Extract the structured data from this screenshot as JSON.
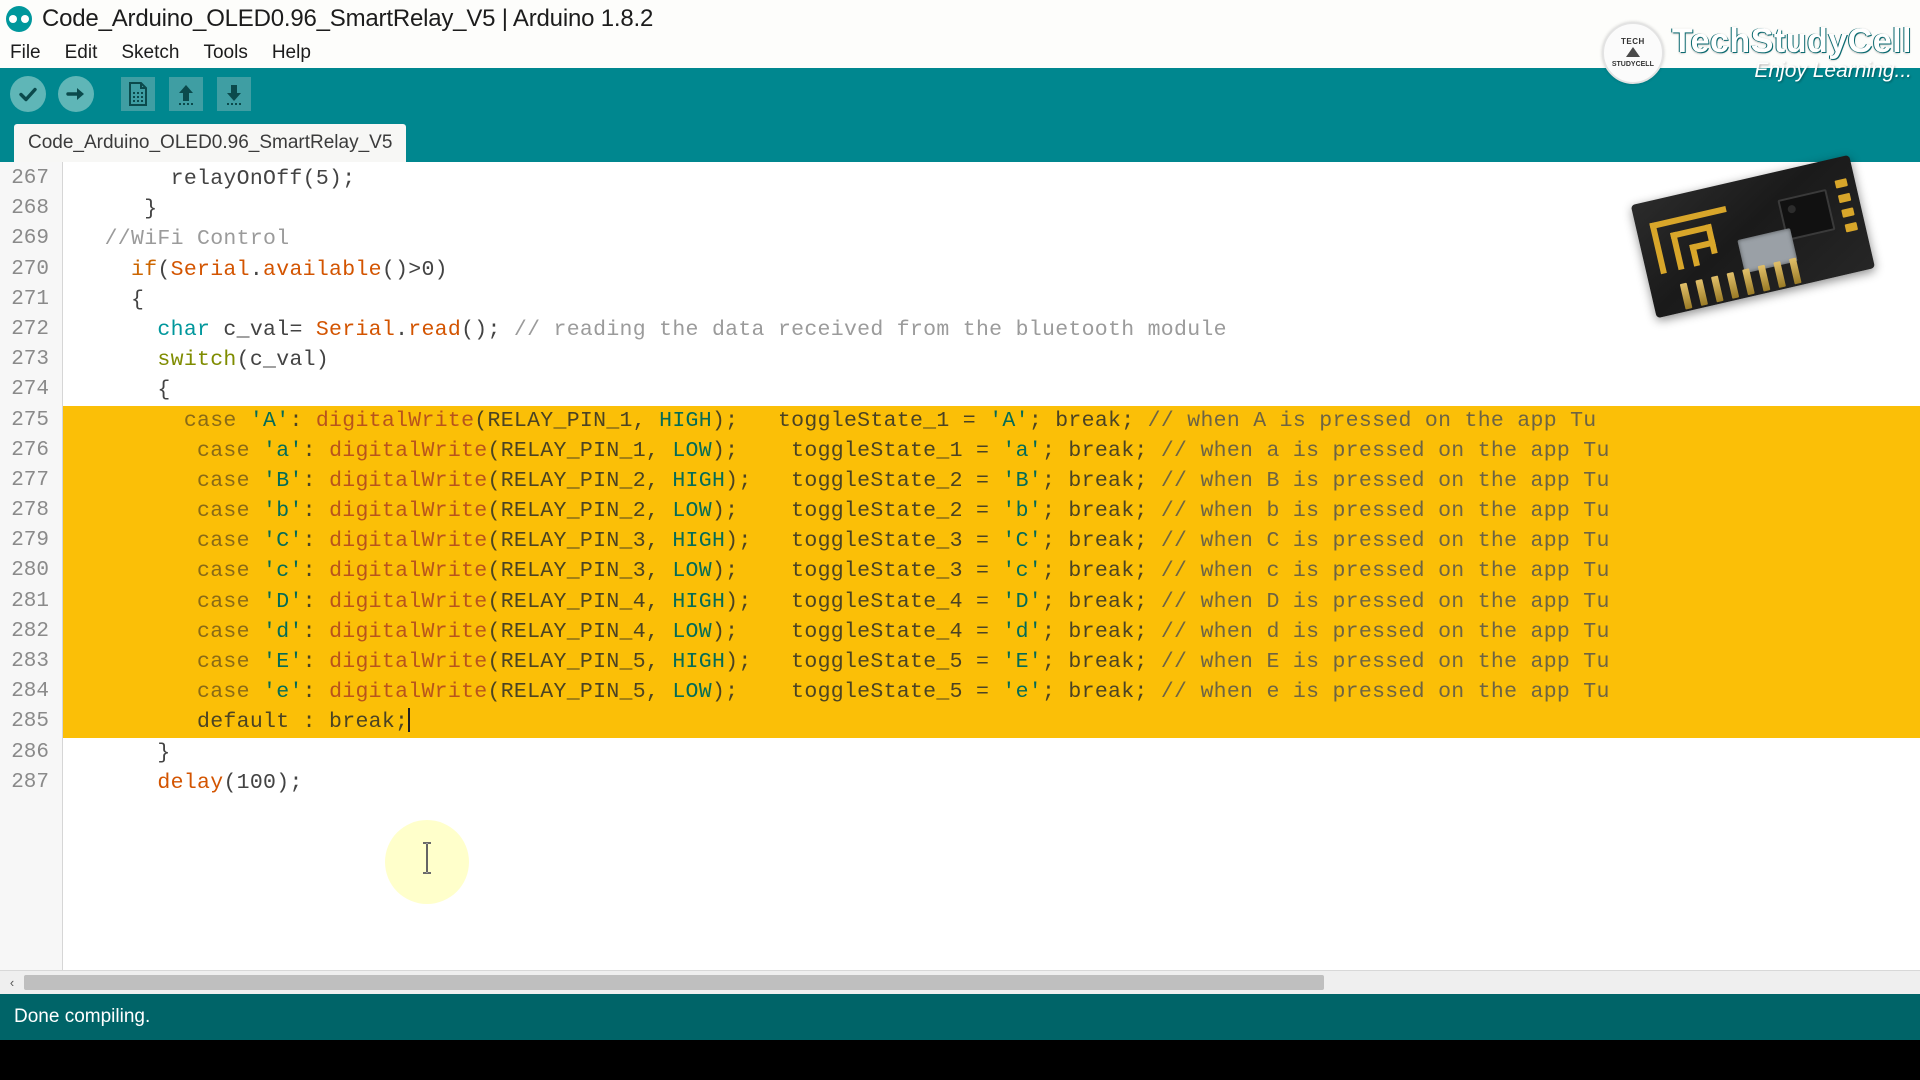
{
  "window": {
    "title": "Code_Arduino_OLED0.96_SmartRelay_V5 | Arduino 1.8.2",
    "app_icon": "arduino-infinity-icon"
  },
  "menubar": {
    "items": [
      {
        "label": "File"
      },
      {
        "label": "Edit"
      },
      {
        "label": "Sketch"
      },
      {
        "label": "Tools"
      },
      {
        "label": "Help"
      }
    ]
  },
  "toolbar": {
    "buttons": [
      {
        "name": "verify-button",
        "icon": "checkmark-icon",
        "tooltip": "Verify"
      },
      {
        "name": "upload-button",
        "icon": "arrow-right-icon",
        "tooltip": "Upload"
      },
      {
        "name": "new-button",
        "icon": "new-document-icon",
        "tooltip": "New"
      },
      {
        "name": "open-button",
        "icon": "arrow-up-icon",
        "tooltip": "Open"
      },
      {
        "name": "save-button",
        "icon": "arrow-down-icon",
        "tooltip": "Save"
      }
    ]
  },
  "tabs": [
    {
      "label": "Code_Arduino_OLED0.96_SmartRelay_V5",
      "active": true
    }
  ],
  "editor": {
    "first_line_number": 267,
    "lines": [
      {
        "n": "267",
        "selected": false,
        "tokens": [
          {
            "t": "        relayOnOff",
            "c": "t-plain"
          },
          {
            "t": "(5);",
            "c": "t-plain"
          }
        ]
      },
      {
        "n": "268",
        "selected": false,
        "tokens": [
          {
            "t": "      }",
            "c": "t-plain"
          }
        ]
      },
      {
        "n": "269",
        "selected": false,
        "tokens": [
          {
            "t": "   //WiFi Control",
            "c": "t-cmt"
          }
        ]
      },
      {
        "n": "270",
        "selected": false,
        "tokens": [
          {
            "t": "     ",
            "c": "t-plain"
          },
          {
            "t": "if",
            "c": "t-kw"
          },
          {
            "t": "(",
            "c": "t-plain"
          },
          {
            "t": "Serial",
            "c": "t-fn"
          },
          {
            "t": ".",
            "c": "t-plain"
          },
          {
            "t": "available",
            "c": "t-fn"
          },
          {
            "t": "()>0)",
            "c": "t-plain"
          }
        ]
      },
      {
        "n": "271",
        "selected": false,
        "tokens": [
          {
            "t": "     {",
            "c": "t-plain"
          }
        ]
      },
      {
        "n": "272",
        "selected": false,
        "tokens": [
          {
            "t": "       ",
            "c": "t-plain"
          },
          {
            "t": "char",
            "c": "t-type"
          },
          {
            "t": " c_val= ",
            "c": "t-plain"
          },
          {
            "t": "Serial",
            "c": "t-fn"
          },
          {
            "t": ".",
            "c": "t-plain"
          },
          {
            "t": "read",
            "c": "t-fn"
          },
          {
            "t": "(); ",
            "c": "t-plain"
          },
          {
            "t": "// reading the data received from the bluetooth module",
            "c": "t-cmt"
          }
        ]
      },
      {
        "n": "273",
        "selected": false,
        "tokens": [
          {
            "t": "       ",
            "c": "t-plain"
          },
          {
            "t": "switch",
            "c": "t-kw2"
          },
          {
            "t": "(c_val)",
            "c": "t-plain"
          }
        ]
      },
      {
        "n": "274",
        "selected": false,
        "tokens": [
          {
            "t": "       {",
            "c": "t-plain"
          }
        ]
      },
      {
        "n": "275",
        "selected": true,
        "tokens": [
          {
            "t": "         ",
            "c": "t-plain"
          },
          {
            "t": "case",
            "c": "t-kw"
          },
          {
            "t": " ",
            "c": "t-plain"
          },
          {
            "t": "'A'",
            "c": "t-lit"
          },
          {
            "t": ": ",
            "c": "t-plain"
          },
          {
            "t": "digitalWrite",
            "c": "t-fn"
          },
          {
            "t": "(RELAY_PIN_1, ",
            "c": "t-plain"
          },
          {
            "t": "HIGH",
            "c": "t-lit"
          },
          {
            "t": ");   toggleState_1 = ",
            "c": "t-plain"
          },
          {
            "t": "'A'",
            "c": "t-lit"
          },
          {
            "t": "; break; ",
            "c": "t-plain"
          },
          {
            "t": "// when A is pressed on the app Tu",
            "c": "t-cmt"
          }
        ]
      },
      {
        "n": "276",
        "selected": true,
        "tokens": [
          {
            "t": "          ",
            "c": "t-plain"
          },
          {
            "t": "case",
            "c": "t-kw"
          },
          {
            "t": " ",
            "c": "t-plain"
          },
          {
            "t": "'a'",
            "c": "t-lit"
          },
          {
            "t": ": ",
            "c": "t-plain"
          },
          {
            "t": "digitalWrite",
            "c": "t-fn"
          },
          {
            "t": "(RELAY_PIN_1, ",
            "c": "t-plain"
          },
          {
            "t": "LOW",
            "c": "t-lit"
          },
          {
            "t": ");    toggleState_1 = ",
            "c": "t-plain"
          },
          {
            "t": "'a'",
            "c": "t-lit"
          },
          {
            "t": "; break; ",
            "c": "t-plain"
          },
          {
            "t": "// when a is pressed on the app Tu",
            "c": "t-cmt"
          }
        ]
      },
      {
        "n": "277",
        "selected": true,
        "tokens": [
          {
            "t": "          ",
            "c": "t-plain"
          },
          {
            "t": "case",
            "c": "t-kw"
          },
          {
            "t": " ",
            "c": "t-plain"
          },
          {
            "t": "'B'",
            "c": "t-lit"
          },
          {
            "t": ": ",
            "c": "t-plain"
          },
          {
            "t": "digitalWrite",
            "c": "t-fn"
          },
          {
            "t": "(RELAY_PIN_2, ",
            "c": "t-plain"
          },
          {
            "t": "HIGH",
            "c": "t-lit"
          },
          {
            "t": ");   toggleState_2 = ",
            "c": "t-plain"
          },
          {
            "t": "'B'",
            "c": "t-lit"
          },
          {
            "t": "; break; ",
            "c": "t-plain"
          },
          {
            "t": "// when B is pressed on the app Tu",
            "c": "t-cmt"
          }
        ]
      },
      {
        "n": "278",
        "selected": true,
        "tokens": [
          {
            "t": "          ",
            "c": "t-plain"
          },
          {
            "t": "case",
            "c": "t-kw"
          },
          {
            "t": " ",
            "c": "t-plain"
          },
          {
            "t": "'b'",
            "c": "t-lit"
          },
          {
            "t": ": ",
            "c": "t-plain"
          },
          {
            "t": "digitalWrite",
            "c": "t-fn"
          },
          {
            "t": "(RELAY_PIN_2, ",
            "c": "t-plain"
          },
          {
            "t": "LOW",
            "c": "t-lit"
          },
          {
            "t": ");    toggleState_2 = ",
            "c": "t-plain"
          },
          {
            "t": "'b'",
            "c": "t-lit"
          },
          {
            "t": "; break; ",
            "c": "t-plain"
          },
          {
            "t": "// when b is pressed on the app Tu",
            "c": "t-cmt"
          }
        ]
      },
      {
        "n": "279",
        "selected": true,
        "tokens": [
          {
            "t": "          ",
            "c": "t-plain"
          },
          {
            "t": "case",
            "c": "t-kw"
          },
          {
            "t": " ",
            "c": "t-plain"
          },
          {
            "t": "'C'",
            "c": "t-lit"
          },
          {
            "t": ": ",
            "c": "t-plain"
          },
          {
            "t": "digitalWrite",
            "c": "t-fn"
          },
          {
            "t": "(RELAY_PIN_3, ",
            "c": "t-plain"
          },
          {
            "t": "HIGH",
            "c": "t-lit"
          },
          {
            "t": ");   toggleState_3 = ",
            "c": "t-plain"
          },
          {
            "t": "'C'",
            "c": "t-lit"
          },
          {
            "t": "; break; ",
            "c": "t-plain"
          },
          {
            "t": "// when C is pressed on the app Tu",
            "c": "t-cmt"
          }
        ]
      },
      {
        "n": "280",
        "selected": true,
        "tokens": [
          {
            "t": "          ",
            "c": "t-plain"
          },
          {
            "t": "case",
            "c": "t-kw"
          },
          {
            "t": " ",
            "c": "t-plain"
          },
          {
            "t": "'c'",
            "c": "t-lit"
          },
          {
            "t": ": ",
            "c": "t-plain"
          },
          {
            "t": "digitalWrite",
            "c": "t-fn"
          },
          {
            "t": "(RELAY_PIN_3, ",
            "c": "t-plain"
          },
          {
            "t": "LOW",
            "c": "t-lit"
          },
          {
            "t": ");    toggleState_3 = ",
            "c": "t-plain"
          },
          {
            "t": "'c'",
            "c": "t-lit"
          },
          {
            "t": "; break; ",
            "c": "t-plain"
          },
          {
            "t": "// when c is pressed on the app Tu",
            "c": "t-cmt"
          }
        ]
      },
      {
        "n": "281",
        "selected": true,
        "tokens": [
          {
            "t": "          ",
            "c": "t-plain"
          },
          {
            "t": "case",
            "c": "t-kw"
          },
          {
            "t": " ",
            "c": "t-plain"
          },
          {
            "t": "'D'",
            "c": "t-lit"
          },
          {
            "t": ": ",
            "c": "t-plain"
          },
          {
            "t": "digitalWrite",
            "c": "t-fn"
          },
          {
            "t": "(RELAY_PIN_4, ",
            "c": "t-plain"
          },
          {
            "t": "HIGH",
            "c": "t-lit"
          },
          {
            "t": ");   toggleState_4 = ",
            "c": "t-plain"
          },
          {
            "t": "'D'",
            "c": "t-lit"
          },
          {
            "t": "; break; ",
            "c": "t-plain"
          },
          {
            "t": "// when D is pressed on the app Tu",
            "c": "t-cmt"
          }
        ]
      },
      {
        "n": "282",
        "selected": true,
        "tokens": [
          {
            "t": "          ",
            "c": "t-plain"
          },
          {
            "t": "case",
            "c": "t-kw"
          },
          {
            "t": " ",
            "c": "t-plain"
          },
          {
            "t": "'d'",
            "c": "t-lit"
          },
          {
            "t": ": ",
            "c": "t-plain"
          },
          {
            "t": "digitalWrite",
            "c": "t-fn"
          },
          {
            "t": "(RELAY_PIN_4, ",
            "c": "t-plain"
          },
          {
            "t": "LOW",
            "c": "t-lit"
          },
          {
            "t": ");    toggleState_4 = ",
            "c": "t-plain"
          },
          {
            "t": "'d'",
            "c": "t-lit"
          },
          {
            "t": "; break; ",
            "c": "t-plain"
          },
          {
            "t": "// when d is pressed on the app Tu",
            "c": "t-cmt"
          }
        ]
      },
      {
        "n": "283",
        "selected": true,
        "tokens": [
          {
            "t": "          ",
            "c": "t-plain"
          },
          {
            "t": "case",
            "c": "t-kw"
          },
          {
            "t": " ",
            "c": "t-plain"
          },
          {
            "t": "'E'",
            "c": "t-lit"
          },
          {
            "t": ": ",
            "c": "t-plain"
          },
          {
            "t": "digitalWrite",
            "c": "t-fn"
          },
          {
            "t": "(RELAY_PIN_5, ",
            "c": "t-plain"
          },
          {
            "t": "HIGH",
            "c": "t-lit"
          },
          {
            "t": ");   toggleState_5 = ",
            "c": "t-plain"
          },
          {
            "t": "'E'",
            "c": "t-lit"
          },
          {
            "t": "; break; ",
            "c": "t-plain"
          },
          {
            "t": "// when E is pressed on the app Tu",
            "c": "t-cmt"
          }
        ]
      },
      {
        "n": "284",
        "selected": true,
        "tokens": [
          {
            "t": "          ",
            "c": "t-plain"
          },
          {
            "t": "case",
            "c": "t-kw"
          },
          {
            "t": " ",
            "c": "t-plain"
          },
          {
            "t": "'e'",
            "c": "t-lit"
          },
          {
            "t": ": ",
            "c": "t-plain"
          },
          {
            "t": "digitalWrite",
            "c": "t-fn"
          },
          {
            "t": "(RELAY_PIN_5, ",
            "c": "t-plain"
          },
          {
            "t": "LOW",
            "c": "t-lit"
          },
          {
            "t": ");    toggleState_5 = ",
            "c": "t-plain"
          },
          {
            "t": "'e'",
            "c": "t-lit"
          },
          {
            "t": "; break; ",
            "c": "t-plain"
          },
          {
            "t": "// when e is pressed on the app Tu",
            "c": "t-cmt"
          }
        ]
      },
      {
        "n": "285",
        "selected": true,
        "tokens": [
          {
            "t": "          default : break;",
            "c": "t-plain"
          }
        ]
      },
      {
        "n": "286",
        "selected": false,
        "tokens": [
          {
            "t": "       }",
            "c": "t-plain"
          }
        ]
      },
      {
        "n": "287",
        "selected": false,
        "tokens": [
          {
            "t": "       ",
            "c": "t-plain"
          },
          {
            "t": "delay",
            "c": "t-fn"
          },
          {
            "t": "(100);",
            "c": "t-plain"
          }
        ]
      }
    ],
    "selection_color": "#fbbf07",
    "caret_line": "285"
  },
  "scrollbar": {
    "left_arrow": "‹",
    "name": "horizontal-scrollbar"
  },
  "status": {
    "message": "Done compiling."
  },
  "branding": {
    "seal_top": "TECH",
    "seal_bottom": "STUDYCELL",
    "name": "TechStudyCell",
    "tagline": "Enjoy Learning..."
  },
  "overlay": {
    "hardware_image": "esp8266-esp-01-wifi-module-photo"
  },
  "colors": {
    "toolbar_bg": "#00878f",
    "status_bg": "#006468",
    "selection": "#fbbf07",
    "accent": "#00979c"
  }
}
